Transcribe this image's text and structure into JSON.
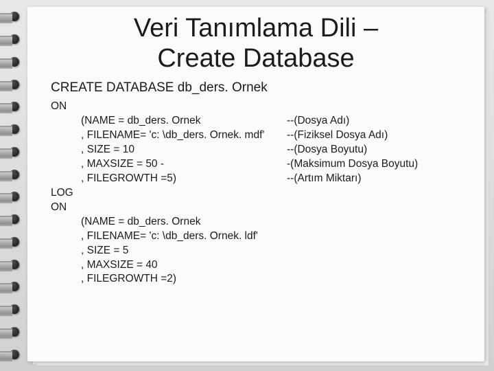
{
  "title_line1": "Veri Tanımlama Dili –",
  "title_line2": "Create Database",
  "subtitle": "CREATE DATABASE db_ders. Ornek",
  "lines": {
    "l0": "ON",
    "l1": "(NAME = db_ders. Ornek",
    "l2": ", FILENAME= 'c: \\db_ders. Ornek. mdf'",
    "l3": ", SIZE = 10",
    "l4": ", MAXSIZE = 50 -",
    "l5": ", FILEGROWTH =5)",
    "l6": "LOG",
    "l7": "ON",
    "l8": "(NAME = db_ders. Ornek",
    "l9": ", FILENAME= 'c: \\db_ders. Ornek. ldf'",
    "l10": ", SIZE = 5",
    "l11": ", MAXSIZE = 40",
    "l12": ", FILEGROWTH =2)"
  },
  "comments": {
    "c1": "--(Dosya Adı)",
    "c2": "--(Fiziksel Dosya Adı)",
    "c3": "--(Dosya Boyutu)",
    "c4": "-(Maksimum Dosya Boyutu)",
    "c5": "--(Artım Miktarı)"
  }
}
